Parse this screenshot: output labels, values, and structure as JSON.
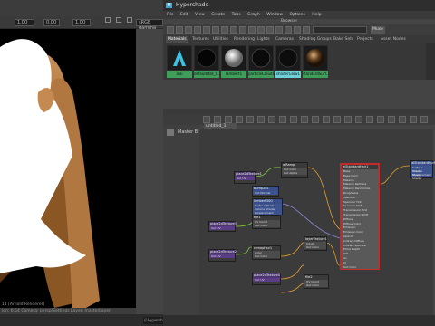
{
  "viewport": {
    "field1": "1.00",
    "field2": "0.00",
    "field3": "1.00",
    "field4": "sRGB gamma",
    "status_line1": "14 [Arnold Renderer]",
    "status_line2": "ion: 6:54 Camera: persp/Settings Layer: masterLayer",
    "cmd_label": "// Hypersh"
  },
  "hypershade": {
    "window_title": "Hypershade",
    "menu": [
      "File",
      "Edit",
      "View",
      "Create",
      "Tabs",
      "Graph",
      "Window",
      "Options",
      "Help"
    ],
    "browser_label": "Browser",
    "search_button": "Muse",
    "tabs": [
      "Materials",
      "Textures",
      "Utilities",
      "Rendering",
      "Lights",
      "Cameras",
      "Shading Groups",
      "Bake Sets",
      "Projects",
      "Asset Nodes"
    ],
    "active_tab": 0,
    "swatches": [
      {
        "label": "aiai",
        "selected": false
      },
      {
        "label": "defaultMat_S...",
        "selected": false
      },
      {
        "label": "lambert1",
        "selected": false
      },
      {
        "label": "particleCloud1",
        "selected": false
      },
      {
        "label": "shaderGlow1",
        "selected": true
      },
      {
        "label": "standardSurf...",
        "selected": false
      }
    ],
    "master_bin": "Master Bi",
    "graph_tab": "untitled_1",
    "nodes": [
      {
        "id": "n1",
        "title": "place2dTexture1",
        "color": "purple",
        "rows": [
          "UV Coord",
          "Out UV"
        ]
      },
      {
        "id": "n2",
        "title": "aiRamp",
        "color": "gray",
        "rows": [
          "Out Color",
          "Out Alpha"
        ]
      },
      {
        "id": "n3",
        "title": "bump2d1",
        "color": "blue",
        "rows": [
          "Bump Value",
          "Bump Depth",
          "Out Normal"
        ]
      },
      {
        "id": "n4",
        "title": "lambert3SG",
        "color": "blue",
        "rows": [
          "Surface Shader",
          "Volume Shader",
          "Displacement Shader"
        ]
      },
      {
        "id": "n5",
        "title": "place2dTexture3",
        "color": "purple",
        "rows": [
          "UV Coord",
          "Out UV"
        ]
      },
      {
        "id": "n6",
        "title": "file1",
        "color": "gray",
        "rows": [
          "UV Coord",
          "Out Color"
        ]
      },
      {
        "id": "n7",
        "title": "place2dTexture2",
        "color": "purple",
        "rows": [
          "UV Coord",
          "Out UV"
        ]
      },
      {
        "id": "n8",
        "title": "remapHsv1",
        "color": "gray",
        "rows": [
          "Color",
          "Out Color"
        ]
      },
      {
        "id": "n9",
        "title": "layerTexture1",
        "color": "gray",
        "rows": [
          "Inputs",
          "Out Color"
        ]
      },
      {
        "id": "n10",
        "title": "place2dTexture4",
        "color": "purple",
        "rows": [
          "UV Coord",
          "Out UV"
        ]
      },
      {
        "id": "n11",
        "title": "file2",
        "color": "gray",
        "rows": [
          "UV Coord",
          "Out Color"
        ]
      },
      {
        "id": "n12",
        "title": "aiStandardSurface2SG",
        "color": "blue",
        "rows": [
          "Surface Shader",
          "Volume Shader",
          "Displacement Shader"
        ]
      }
    ],
    "big_node": {
      "title": "aiStandardHair1",
      "rows": [
        "Base",
        "Base Color",
        "Melanin",
        "Melanin Redness",
        "Melanin Randomize",
        "Roughness",
        "Specular",
        "Specular Tint",
        "Specular Shift",
        "Transmission Tint",
        "Transmission Shift",
        "Diffuse",
        "Diffuse Color",
        "Emission",
        "Emission Color",
        "Opacity",
        "Indirect Diffuse",
        "Indirect Specular",
        "Extra Depth",
        "IOR",
        "Ax",
        "Id",
        "Out Color"
      ]
    }
  }
}
